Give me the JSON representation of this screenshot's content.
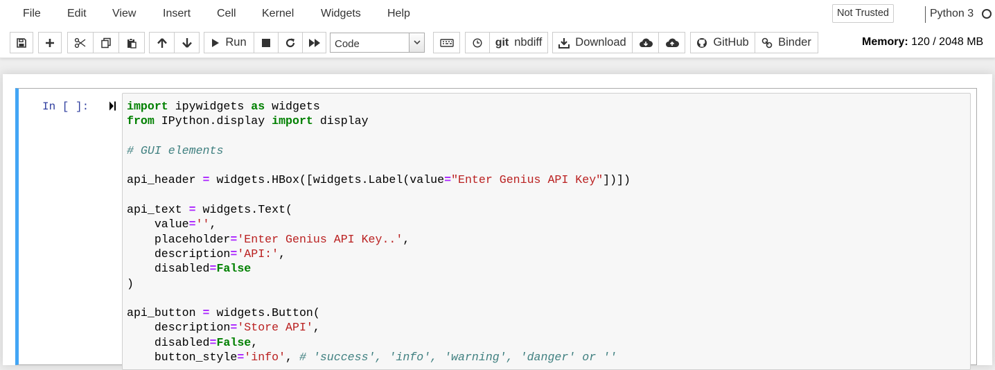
{
  "menu": [
    {
      "id": "file",
      "label": "File"
    },
    {
      "id": "edit",
      "label": "Edit"
    },
    {
      "id": "view",
      "label": "View"
    },
    {
      "id": "insert",
      "label": "Insert"
    },
    {
      "id": "cell",
      "label": "Cell"
    },
    {
      "id": "kernel",
      "label": "Kernel"
    },
    {
      "id": "widgets",
      "label": "Widgets"
    },
    {
      "id": "help",
      "label": "Help"
    }
  ],
  "trust_label": "Not Trusted",
  "kernel": {
    "name": "Python 3"
  },
  "toolbar": {
    "run_label": "Run",
    "cell_type": "Code",
    "git_label": "git",
    "nbdiff_label": "nbdiff",
    "download_label": "Download",
    "github_label": "GitHub",
    "binder_label": "Binder",
    "icons": [
      "save-icon",
      "plus-icon",
      "cut-icon",
      "copy-icon",
      "paste-icon",
      "arrow-up-icon",
      "arrow-down-icon",
      "play-icon",
      "stop-icon",
      "restart-icon",
      "fast-forward-icon",
      "keyboard-icon",
      "clock-icon",
      "git-icon",
      "download-icon",
      "cloud-download-icon",
      "cloud-upload-icon",
      "github-icon",
      "link-icon"
    ]
  },
  "memory": {
    "label": "Memory:",
    "value": "120 / 2048 MB"
  },
  "cell": {
    "prompt": "In [ ]:",
    "accent_color": "#42a5f5",
    "code_lines": [
      [
        [
          "kw",
          "import"
        ],
        [
          "plain",
          " ipywidgets "
        ],
        [
          "kw",
          "as"
        ],
        [
          "plain",
          " widgets"
        ]
      ],
      [
        [
          "kw",
          "from"
        ],
        [
          "plain",
          " IPython.display "
        ],
        [
          "kw",
          "import"
        ],
        [
          "plain",
          " display"
        ]
      ],
      [],
      [
        [
          "cm",
          "# GUI elements"
        ]
      ],
      [],
      [
        [
          "plain",
          "api_header "
        ],
        [
          "op",
          "="
        ],
        [
          "plain",
          " widgets.HBox([widgets.Label(value"
        ],
        [
          "op",
          "="
        ],
        [
          "str",
          "\"Enter Genius API Key\""
        ],
        [
          "plain",
          "])])"
        ]
      ],
      [],
      [
        [
          "plain",
          "api_text "
        ],
        [
          "op",
          "="
        ],
        [
          "plain",
          " widgets.Text("
        ]
      ],
      [
        [
          "plain",
          "    value"
        ],
        [
          "op",
          "="
        ],
        [
          "str",
          "''"
        ],
        [
          "plain",
          ","
        ]
      ],
      [
        [
          "plain",
          "    placeholder"
        ],
        [
          "op",
          "="
        ],
        [
          "str",
          "'Enter Genius API Key..'"
        ],
        [
          "plain",
          ","
        ]
      ],
      [
        [
          "plain",
          "    description"
        ],
        [
          "op",
          "="
        ],
        [
          "str",
          "'API:'"
        ],
        [
          "plain",
          ","
        ]
      ],
      [
        [
          "plain",
          "    disabled"
        ],
        [
          "op",
          "="
        ],
        [
          "kw",
          "False"
        ]
      ],
      [
        [
          "plain",
          ")"
        ]
      ],
      [],
      [
        [
          "plain",
          "api_button "
        ],
        [
          "op",
          "="
        ],
        [
          "plain",
          " widgets.Button("
        ]
      ],
      [
        [
          "plain",
          "    description"
        ],
        [
          "op",
          "="
        ],
        [
          "str",
          "'Store API'"
        ],
        [
          "plain",
          ","
        ]
      ],
      [
        [
          "plain",
          "    disabled"
        ],
        [
          "op",
          "="
        ],
        [
          "kw",
          "False"
        ],
        [
          "plain",
          ","
        ]
      ],
      [
        [
          "plain",
          "    button_style"
        ],
        [
          "op",
          "="
        ],
        [
          "str",
          "'info'"
        ],
        [
          "plain",
          ", "
        ],
        [
          "cm",
          "# 'success', 'info', 'warning', 'danger' or ''"
        ]
      ]
    ]
  }
}
